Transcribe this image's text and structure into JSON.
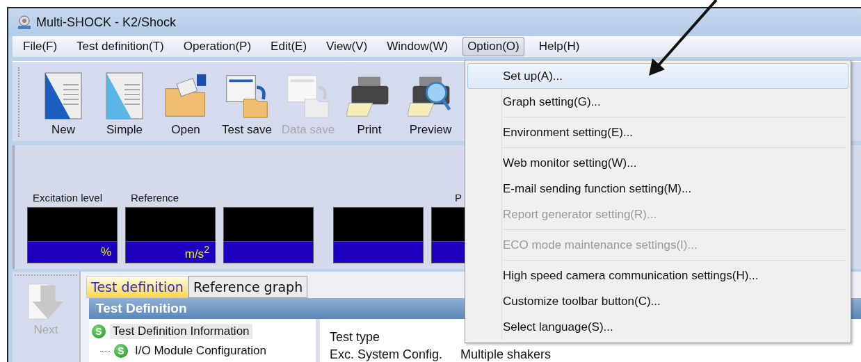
{
  "window": {
    "title": "Multi-SHOCK - K2/Shock"
  },
  "menu_bar": [
    {
      "label": "File(F)",
      "selected": false
    },
    {
      "label": "Test definition(T)",
      "selected": false
    },
    {
      "label": "Operation(P)",
      "selected": false
    },
    {
      "label": "Edit(E)",
      "selected": false
    },
    {
      "label": "View(V)",
      "selected": false
    },
    {
      "label": "Window(W)",
      "selected": false
    },
    {
      "label": "Option(O)",
      "selected": true
    },
    {
      "label": "Help(H)",
      "selected": false
    }
  ],
  "toolbar": [
    {
      "label": "New",
      "disabled": false
    },
    {
      "label": "Simple",
      "disabled": false
    },
    {
      "label": "Open",
      "disabled": false
    },
    {
      "label": "Test save",
      "disabled": false
    },
    {
      "label": "Data save",
      "disabled": true
    },
    {
      "label": "Print",
      "disabled": false
    },
    {
      "label": "Preview",
      "disabled": false
    }
  ],
  "meters": [
    {
      "kind": "meter",
      "label": "Excitation level",
      "unit": "%"
    },
    {
      "kind": "meter",
      "label": "Reference",
      "unit": "m/s$^{2}$"
    },
    {
      "kind": "meter"
    },
    {
      "kind": "meter"
    },
    {
      "kind": "meter",
      "label": "P"
    }
  ],
  "side_panel": {
    "next_label": "Next"
  },
  "tabs": [
    {
      "label": "Test definition",
      "selected": true
    },
    {
      "label": "Reference graph",
      "selected": false
    }
  ],
  "panel_title": "Test Definition",
  "tree": [
    {
      "badge": "S",
      "label": "Test Definition Information",
      "selected": true,
      "children": [
        {
          "badge": "S",
          "label": "I/O Module Configuration",
          "selected": false
        }
      ]
    }
  ],
  "details": {
    "heading": "Test type",
    "rows": [
      {
        "label": "Exc. System Config.",
        "value": "Multiple shakers"
      }
    ]
  },
  "dropdown": [
    {
      "kind": "item",
      "label": "Set up(A)...",
      "selected": true,
      "disabled": false
    },
    {
      "kind": "item",
      "label": "Graph setting(G)...",
      "selected": false,
      "disabled": false
    },
    {
      "kind": "separator"
    },
    {
      "kind": "item",
      "label": "Environment setting(E)...",
      "selected": false,
      "disabled": false
    },
    {
      "kind": "separator"
    },
    {
      "kind": "item",
      "label": "Web monitor setting(W)...",
      "selected": false,
      "disabled": false
    },
    {
      "kind": "item",
      "label": "E-mail sending function setting(M)...",
      "selected": false,
      "disabled": false
    },
    {
      "kind": "item",
      "label": "Report generator setting(R)...",
      "selected": false,
      "disabled": true
    },
    {
      "kind": "separator"
    },
    {
      "kind": "item",
      "label": "ECO mode maintenance settings(I)...",
      "selected": false,
      "disabled": true
    },
    {
      "kind": "separator"
    },
    {
      "kind": "item",
      "label": "High speed camera communication settings(H)...",
      "selected": false,
      "disabled": false
    },
    {
      "kind": "item",
      "label": "Customize toolbar button(C)...",
      "selected": false,
      "disabled": false
    },
    {
      "kind": "item",
      "label": "Select language(S)...",
      "selected": false,
      "disabled": false
    }
  ]
}
